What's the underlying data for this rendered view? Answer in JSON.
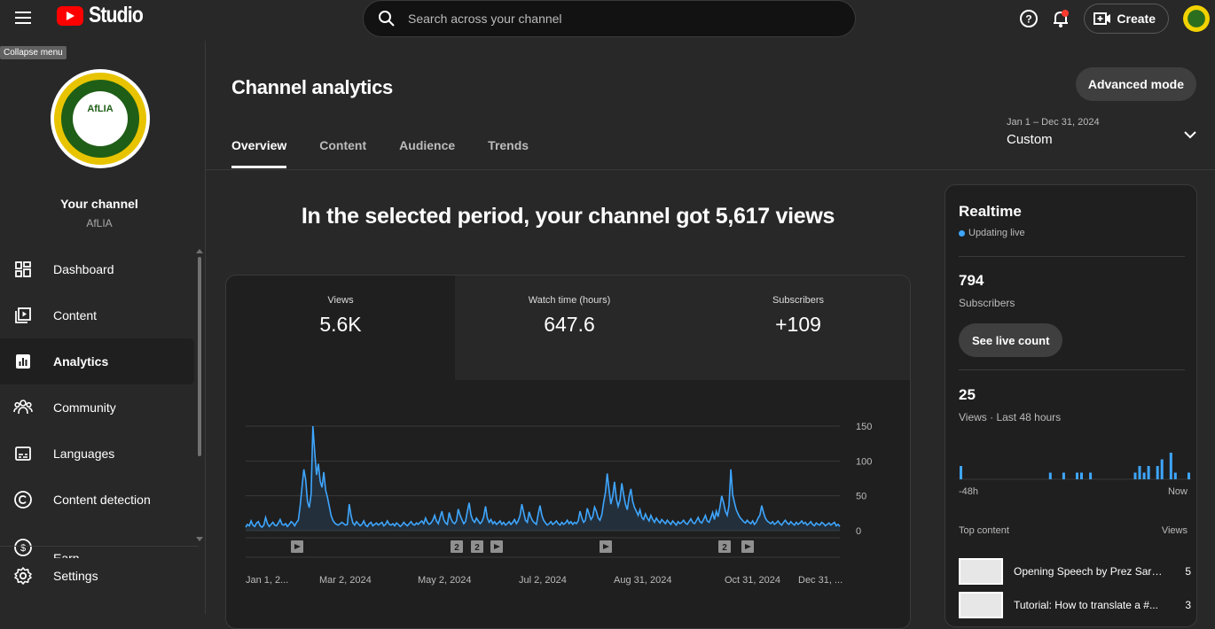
{
  "header": {
    "logo_text": "Studio",
    "tooltip": "Collapse menu",
    "search_placeholder": "Search across your channel",
    "create_label": "Create"
  },
  "sidebar": {
    "channel_avatar_text": "AfLIA",
    "your_channel": "Your channel",
    "handle": "AfLIA",
    "items": [
      {
        "label": "Dashboard",
        "icon": "dashboard-icon"
      },
      {
        "label": "Content",
        "icon": "content-icon"
      },
      {
        "label": "Analytics",
        "icon": "analytics-icon"
      },
      {
        "label": "Community",
        "icon": "community-icon"
      },
      {
        "label": "Languages",
        "icon": "languages-icon"
      },
      {
        "label": "Content detection",
        "icon": "copyright-icon"
      },
      {
        "label": "Earn",
        "icon": "earn-icon"
      }
    ],
    "settings": "Settings"
  },
  "main": {
    "title": "Channel analytics",
    "advanced_mode": "Advanced mode",
    "tabs": [
      "Overview",
      "Content",
      "Audience",
      "Trends"
    ],
    "date_range": "Jan 1 – Dec 31, 2024",
    "date_preset": "Custom",
    "headline": "In the selected period, your channel got 5,617 views",
    "metrics": [
      {
        "label": "Views",
        "value": "5.6K"
      },
      {
        "label": "Watch time (hours)",
        "value": "647.6"
      },
      {
        "label": "Subscribers",
        "value": "+109"
      }
    ]
  },
  "chart_data": {
    "type": "line",
    "ylim": [
      0,
      150
    ],
    "yticks": [
      0,
      50,
      100,
      150
    ],
    "xtick_labels": [
      "Jan 1, 2...",
      "Mar 2, 2024",
      "May 2, 2024",
      "Jul 2, 2024",
      "Aug 31, 2024",
      "Oct 31, 2024",
      "Dec 31, ..."
    ],
    "values": [
      5,
      9,
      7,
      14,
      8,
      6,
      11,
      13,
      7,
      5,
      8,
      19,
      10,
      6,
      9,
      12,
      8,
      7,
      11,
      16,
      9,
      8,
      10,
      6,
      9,
      13,
      11,
      7,
      12,
      15,
      36,
      62,
      88,
      74,
      42,
      33,
      52,
      150,
      112,
      80,
      96,
      71,
      62,
      84,
      58,
      48,
      35,
      22,
      15,
      11,
      9,
      8,
      10,
      12,
      10,
      8,
      9,
      38,
      22,
      11,
      8,
      13,
      10,
      7,
      9,
      14,
      8,
      6,
      10,
      12,
      7,
      9,
      11,
      8,
      10,
      12,
      7,
      9,
      14,
      9,
      8,
      10,
      7,
      11,
      9,
      6,
      8,
      12,
      9,
      7,
      10,
      13,
      9,
      8,
      11,
      9,
      12,
      14,
      10,
      18,
      12,
      9,
      11,
      15,
      22,
      14,
      10,
      19,
      28,
      16,
      11,
      9,
      26,
      17,
      12,
      10,
      14,
      31,
      22,
      16,
      10,
      13,
      28,
      40,
      22,
      15,
      12,
      18,
      14,
      10,
      13,
      20,
      35,
      18,
      12,
      16,
      10,
      13,
      9,
      11,
      14,
      9,
      12,
      8,
      10,
      13,
      9,
      12,
      16,
      10,
      14,
      22,
      38,
      26,
      15,
      12,
      27,
      19,
      14,
      11,
      9,
      24,
      36,
      22,
      15,
      11,
      8,
      10,
      13,
      9,
      11,
      14,
      10,
      8,
      12,
      9,
      11,
      15,
      10,
      13,
      9,
      12,
      10,
      14,
      28,
      18,
      12,
      15,
      32,
      24,
      16,
      20,
      34,
      28,
      18,
      15,
      23,
      40,
      55,
      82,
      58,
      38,
      50,
      70,
      46,
      35,
      44,
      68,
      52,
      38,
      30,
      48,
      60,
      42,
      33,
      28,
      22,
      30,
      19,
      16,
      24,
      18,
      14,
      22,
      16,
      12,
      18,
      14,
      11,
      16,
      13,
      10,
      15,
      12,
      9,
      14,
      11,
      8,
      13,
      10,
      12,
      15,
      11,
      9,
      13,
      17,
      12,
      10,
      14,
      19,
      13,
      11,
      16,
      22,
      14,
      12,
      18,
      26,
      16,
      28,
      20,
      34,
      50,
      40,
      28,
      22,
      36,
      88,
      52,
      40,
      30,
      24,
      19,
      16,
      13,
      11,
      15,
      12,
      10,
      14,
      9,
      12,
      18,
      22,
      36,
      26,
      18,
      14,
      12,
      10,
      13,
      9,
      11,
      14,
      10,
      8,
      12,
      15,
      11,
      9,
      13,
      10,
      8,
      12,
      9,
      11,
      14,
      10,
      12,
      8,
      10,
      13,
      9,
      7,
      11,
      9,
      8,
      12,
      10,
      7,
      9,
      11,
      8,
      10,
      12,
      7,
      9,
      6
    ]
  },
  "realtime": {
    "title": "Realtime",
    "live_label": "Updating live",
    "subs_value": "794",
    "subs_label": "Subscribers",
    "see_live": "See live count",
    "views_value": "25",
    "views_label": "Views · Last 48 hours",
    "axis_left": "-48h",
    "axis_right": "Now",
    "bars": [
      2,
      0,
      0,
      0,
      0,
      0,
      0,
      0,
      0,
      0,
      0,
      0,
      0,
      0,
      0,
      0,
      0,
      0,
      0,
      0,
      1,
      0,
      0,
      1,
      0,
      0,
      1,
      1,
      0,
      1,
      0,
      0,
      0,
      0,
      0,
      0,
      0,
      0,
      0,
      1,
      2,
      1,
      2,
      0,
      2,
      3,
      0,
      4,
      1,
      0,
      0,
      1
    ],
    "top_content_label": "Top content",
    "top_content_views": "Views",
    "top_items": [
      {
        "title": "Opening Speech by Prez Sara...",
        "views": "5"
      },
      {
        "title": "Tutorial: How to translate a #...",
        "views": "3"
      }
    ]
  },
  "colors": {
    "accent": "#3ea6ff",
    "brand": "#ff0000"
  }
}
